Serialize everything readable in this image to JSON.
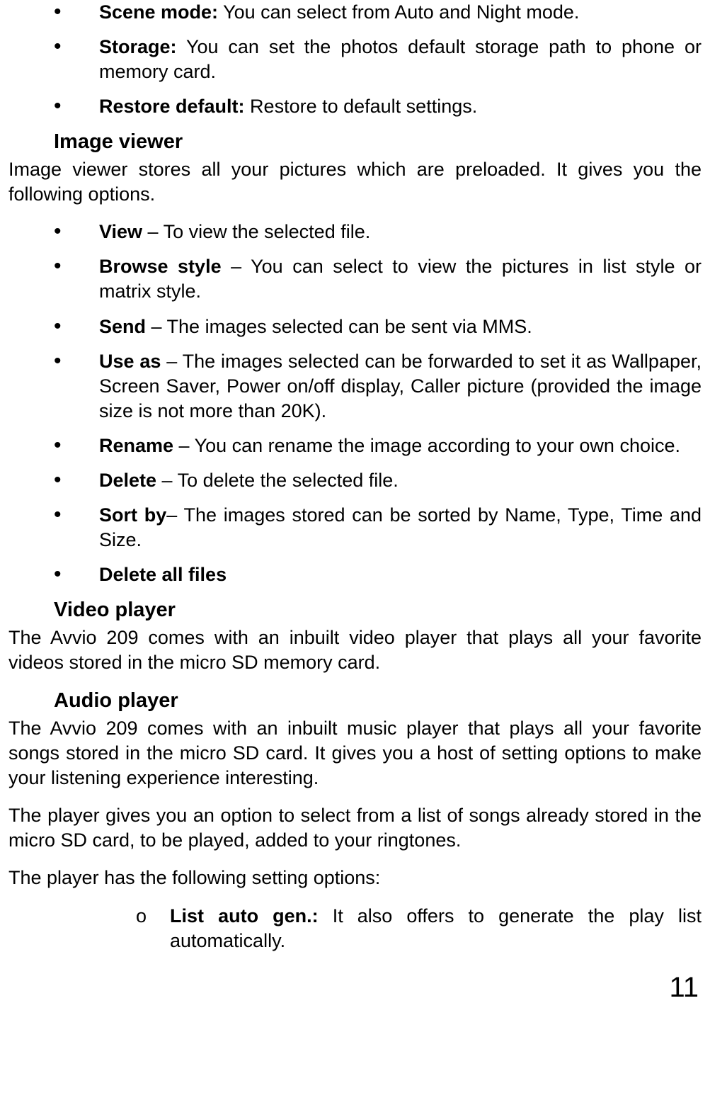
{
  "cameraOptions": [
    {
      "label": "Scene mode:",
      "text": " You can select from Auto and Night mode."
    },
    {
      "label": "Storage:",
      "text": " You can set the photos default storage path to phone or memory card."
    },
    {
      "label": "Restore default:",
      "text": " Restore to default settings."
    }
  ],
  "imageViewer": {
    "heading": "Image viewer",
    "intro": "Image viewer stores all your pictures which are preloaded. It gives you the following options.",
    "items": [
      {
        "label": "View",
        "text": " – To view the selected file."
      },
      {
        "label": "Browse style",
        "text": " – You can select to view the pictures in list style or matrix style."
      },
      {
        "label": "Send",
        "text": " – The images selected can be sent via MMS."
      },
      {
        "label": "Use as",
        "text": " – The images selected can be forwarded to set it as Wallpaper, Screen Saver, Power on/off display, Caller picture (provided the image size is not more than 20K)."
      },
      {
        "label": "Rename",
        "text": " – You can rename the image according to your own choice."
      },
      {
        "label": "Delete",
        "text": " – To delete the selected file."
      },
      {
        "label": "Sort by",
        "text": "– The images stored can be sorted by Name, Type, Time and Size."
      },
      {
        "label": "Delete all files",
        "text": ""
      }
    ]
  },
  "videoPlayer": {
    "heading": "Video player",
    "intro": "The Avvio 209 comes with an inbuilt video player that plays all your favorite videos stored in the micro SD memory card."
  },
  "audioPlayer": {
    "heading": "Audio player",
    "intro1": "The Avvio 209 comes with an inbuilt music player that plays all your favorite songs stored in the micro SD card. It gives you a host of setting options to make your listening experience interesting.",
    "intro2": "The player gives you an option to select from a list of songs already stored in the micro SD card, to be played, added to your ringtones.",
    "intro3": "The player has the following setting options:",
    "items": [
      {
        "label": "List auto gen.:",
        "text": " It also offers to generate the play list automatically."
      }
    ]
  },
  "pageNumber": "11"
}
